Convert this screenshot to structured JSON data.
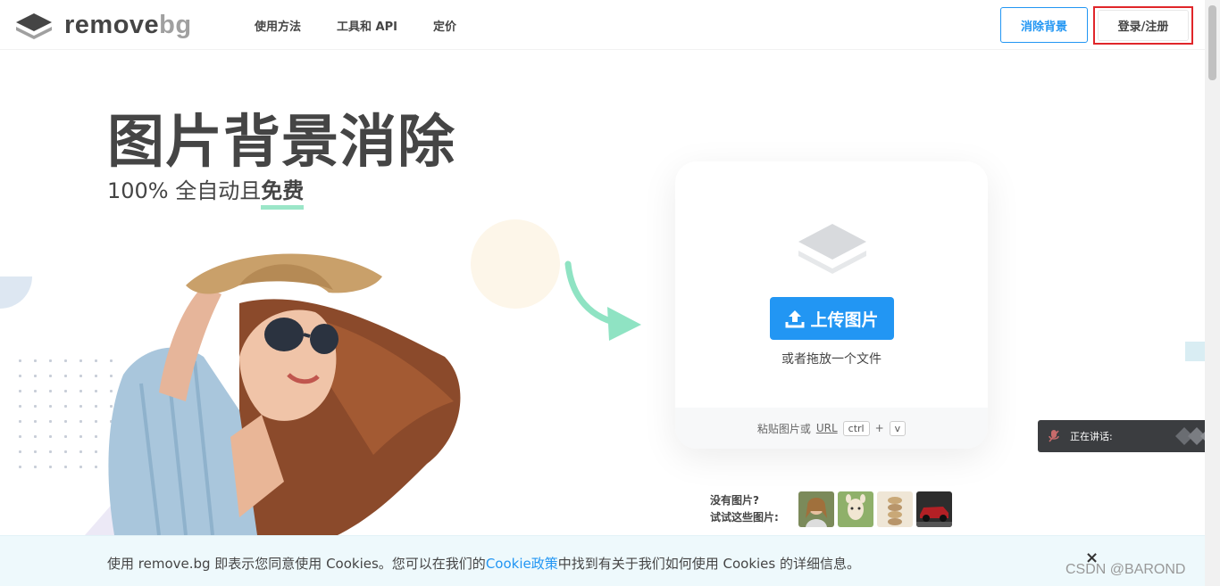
{
  "header": {
    "logo_main": "remove",
    "logo_accent": "bg",
    "nav": [
      "使用方法",
      "工具和 API",
      "定价"
    ],
    "remove_bg_button": "消除背景",
    "login_button": "登录/注册"
  },
  "hero": {
    "title": "图片背景消除",
    "subtitle_prefix": "100% 全自动且",
    "subtitle_emphasis": "免费"
  },
  "upload": {
    "button_label": "上传图片",
    "drag_text": "或者拖放一个文件",
    "paste_prefix": "粘贴图片或",
    "paste_url": "URL",
    "key_ctrl": "ctrl",
    "key_plus": "+",
    "key_v": "v"
  },
  "samples": {
    "line1": "没有图片?",
    "line2": "试试这些图片:"
  },
  "speaking_widget": {
    "label": "正在讲话:"
  },
  "cookie": {
    "text_before": "使用 remove.bg 即表示您同意使用 Cookies。您可以在我们的",
    "link": "Cookie政策",
    "text_after": "中找到有关于我们如何使用 Cookies 的详细信息。",
    "close": "×"
  },
  "watermark": "CSDN @BAROND",
  "colors": {
    "brand_blue": "#2296f3",
    "text": "#454545",
    "accent_green": "#9be6c8",
    "highlight_red": "#e0262a"
  }
}
